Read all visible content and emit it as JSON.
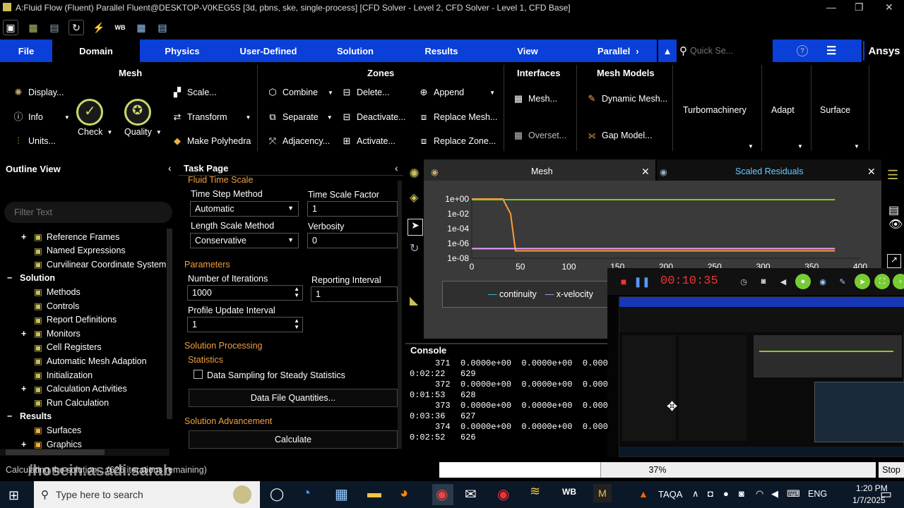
{
  "window": {
    "title": "A:Fluid Flow (Fluent) Parallel Fluent@DESKTOP-V0KEG5S [3d, pbns, ske, single-process] [CFD Solver - Level 2, CFD Solver - Level 1, CFD Base]"
  },
  "tabs": [
    "File",
    "Domain",
    "Physics",
    "User-Defined",
    "Solution",
    "Results",
    "View",
    "Parallel"
  ],
  "quick_search": {
    "placeholder": "Quick Se..."
  },
  "brand": "Ansys",
  "ribbon": {
    "mesh": {
      "header": "Mesh",
      "display": "Display...",
      "info": "Info",
      "units": "Units...",
      "check": "Check",
      "quality": "Quality",
      "scale": "Scale...",
      "transform": "Transform",
      "make_polyhedra": "Make Polyhedra"
    },
    "zones": {
      "header": "Zones",
      "combine": "Combine",
      "separate": "Separate",
      "adjacency": "Adjacency...",
      "delete": "Delete...",
      "deactivate": "Deactivate...",
      "activate": "Activate...",
      "append": "Append",
      "replace_mesh": "Replace Mesh...",
      "replace_zone": "Replace Zone..."
    },
    "interfaces": {
      "header": "Interfaces",
      "mesh": "Mesh...",
      "overset": "Overset..."
    },
    "mesh_models": {
      "header": "Mesh Models",
      "dynamic_mesh": "Dynamic Mesh...",
      "gap_model": "Gap Model..."
    },
    "turbomachinery": "Turbomachinery",
    "adapt": "Adapt",
    "surface": "Surface"
  },
  "outline": {
    "title": "Outline View",
    "filter_placeholder": "Filter Text",
    "items": [
      {
        "label": "Reference Frames",
        "expander": "+"
      },
      {
        "label": "Named Expressions",
        "expander": ""
      },
      {
        "label": "Curvilinear Coordinate System",
        "expander": ""
      },
      {
        "label": "Solution",
        "expander": "−",
        "bold": true
      },
      {
        "label": "Methods",
        "expander": ""
      },
      {
        "label": "Controls",
        "expander": ""
      },
      {
        "label": "Report Definitions",
        "expander": ""
      },
      {
        "label": "Monitors",
        "expander": "+"
      },
      {
        "label": "Cell Registers",
        "expander": ""
      },
      {
        "label": "Automatic Mesh Adaption",
        "expander": ""
      },
      {
        "label": "Initialization",
        "expander": ""
      },
      {
        "label": "Calculation Activities",
        "expander": "+"
      },
      {
        "label": "Run Calculation",
        "expander": ""
      },
      {
        "label": "Results",
        "expander": "−",
        "bold": true
      },
      {
        "label": "Surfaces",
        "expander": ""
      },
      {
        "label": "Graphics",
        "expander": "+"
      }
    ]
  },
  "task": {
    "title": "Task Page",
    "section_fluid_time_scale": "Fluid Time Scale",
    "time_step_method_label": "Time Step Method",
    "time_step_method_value": "Automatic",
    "time_scale_factor_label": "Time Scale Factor",
    "time_scale_factor_value": "1",
    "length_scale_method_label": "Length Scale Method",
    "length_scale_method_value": "Conservative",
    "verbosity_label": "Verbosity",
    "verbosity_value": "0",
    "section_parameters": "Parameters",
    "iterations_label": "Number of Iterations",
    "iterations_value": "1000",
    "reporting_interval_label": "Reporting Interval",
    "reporting_interval_value": "1",
    "profile_update_label": "Profile Update Interval",
    "profile_update_value": "1",
    "section_processing": "Solution Processing",
    "statistics_label": "Statistics",
    "data_sampling_label": "Data Sampling for Steady Statistics",
    "data_file_button": "Data File Quantities...",
    "section_advancement": "Solution Advancement",
    "calculate_button": "Calculate"
  },
  "graphics": {
    "tab_mesh": "Mesh",
    "tab_residuals": "Scaled Residuals",
    "legend": [
      "continuity",
      "x-velocity"
    ]
  },
  "chart_data": {
    "type": "line",
    "title": "Scaled Residuals",
    "xlabel": "",
    "ylabel": "",
    "xlim": [
      0,
      400
    ],
    "ylim_log": [
      -8,
      0
    ],
    "y_scale": "log",
    "x_ticks": [
      0,
      50,
      100,
      150,
      200,
      250,
      300,
      350,
      400
    ],
    "y_ticks": [
      "1e+00",
      "1e-02",
      "1e-04",
      "1e-06",
      "1e-08"
    ],
    "series": [
      {
        "name": "continuity",
        "color": "#ff9a3c",
        "x": [
          0,
          25,
          32,
          40,
          45,
          374
        ],
        "y": [
          1,
          1,
          1,
          0.01,
          1e-07,
          1e-07
        ]
      },
      {
        "name": "x-velocity",
        "color": "#e8a0ff",
        "x": [
          0,
          45,
          374
        ],
        "y": [
          2e-07,
          2e-07,
          2e-07
        ]
      },
      {
        "name": "",
        "color": "#8ac926",
        "x": [
          0,
          374
        ],
        "y": [
          0.8,
          0.8
        ]
      }
    ]
  },
  "console": {
    "title": "Console",
    "lines": [
      "     371  0.0000e+00  0.0000e+00  0.000",
      "0:02:22   629",
      "     372  0.0000e+00  0.0000e+00  0.000",
      "0:01:53   628",
      "     373  0.0000e+00  0.0000e+00  0.000",
      "0:03:36   627",
      "     374  0.0000e+00  0.0000e+00  0.000",
      "0:02:52   626"
    ]
  },
  "status": {
    "text": "Calculating the solution... (626 iterations remaining)",
    "watermark": "/hosein.asadi.sarab",
    "progress_label": "37%",
    "progress": 0.37,
    "stop": "Stop"
  },
  "recorder": {
    "time": "00:10:35"
  },
  "taskbar": {
    "search_placeholder": "Type here to search",
    "taqa": "TAQA",
    "lang": "ENG",
    "time": "1:20 PM",
    "date": "1/7/2025"
  }
}
